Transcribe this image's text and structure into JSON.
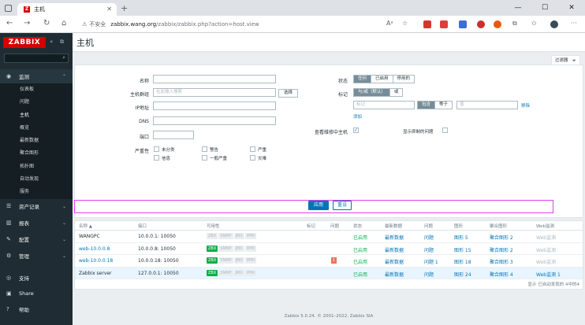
{
  "browser": {
    "tab_title": "主机",
    "tab_favicon": "Z",
    "url_warning": "不安全",
    "url_host": "zabbix.wang.org",
    "url_path": "/zabbix/zabbix.php?action=host.view"
  },
  "sidebar": {
    "logo": "ZABBIX",
    "menu": [
      {
        "label": "监测",
        "icon": "eye-icon"
      },
      {
        "label": "资产记录",
        "icon": "list-icon"
      },
      {
        "label": "报表",
        "icon": "chart-icon"
      },
      {
        "label": "配置",
        "icon": "wrench-icon"
      },
      {
        "label": "管理",
        "icon": "gear-icon"
      }
    ],
    "submenu": [
      "仪表板",
      "问题",
      "主机",
      "概览",
      "最新数据",
      "聚合图形",
      "拓扑图",
      "自动发现",
      "服务"
    ],
    "bottom": [
      {
        "label": "支持",
        "icon": "support-icon"
      },
      {
        "label": "Share",
        "icon": "share-icon"
      },
      {
        "label": "帮助",
        "icon": "help-icon"
      }
    ]
  },
  "page": {
    "title": "主机",
    "filter_tab": "过滤器"
  },
  "filter": {
    "name_label": "名称",
    "group_label": "主机群组",
    "group_placeholder": "在此输入搜索",
    "select_btn": "选择",
    "ip_label": "IP地址",
    "dns_label": "DNS",
    "port_label": "端口",
    "severity_label": "严重性",
    "severities": [
      "未分类",
      "警告",
      "严重",
      "信息",
      "一般严重",
      "灾难"
    ],
    "status_label": "状态",
    "status_options": [
      "任何",
      "已启用",
      "停用的"
    ],
    "tags_label": "标记",
    "tag_ops": [
      "与/或（默认）",
      "或"
    ],
    "tag_placeholder": "标记",
    "tag_contains": "包含",
    "tag_equals": "等于",
    "tag_value_placeholder": "值",
    "tag_remove": "移除",
    "tag_add": "添加",
    "maint_label": "查看维修中主机",
    "suppressed_label": "显示抑制的问题",
    "apply": "应用",
    "reset": "重设"
  },
  "table": {
    "headers": [
      "名称 ▲",
      "接口",
      "可用性",
      "标记",
      "问题",
      "状态",
      "最新数据",
      "问题",
      "图形",
      "聚合图形",
      "Web监测"
    ],
    "rows": [
      {
        "name": "WANGPC",
        "iface": "10.0.0.1: 10050",
        "status": "已启用",
        "latest": "最新数据",
        "problems": "问题",
        "graphs": "图形 5",
        "screens": "聚合图形 2",
        "web": "Web监测",
        "zbx_on": false,
        "problem_badge": ""
      },
      {
        "name": "web-10.0.0.8",
        "iface": "10.0.0.8: 10050",
        "status": "已启用",
        "latest": "最新数据",
        "problems": "问题",
        "graphs": "图形 15",
        "screens": "聚合图形 2",
        "web": "Web监测",
        "zbx_on": true,
        "problem_badge": ""
      },
      {
        "name": "web-10.0.0.18",
        "iface": "10.0.0.18: 10050",
        "status": "已启用",
        "latest": "最新数据",
        "problems": "问题 1",
        "graphs": "图形 18",
        "screens": "聚合图形 3",
        "web": "Web监测",
        "zbx_on": true,
        "problem_badge": "1"
      },
      {
        "name": "Zabbix server",
        "iface": "127.0.0.1: 10050",
        "status": "已启用",
        "latest": "最新数据",
        "problems": "问题",
        "graphs": "图形 24",
        "screens": "聚合图形 4",
        "web": "Web监测 1",
        "zbx_on": true,
        "problem_badge": ""
      }
    ],
    "avail_labels": [
      "ZBX",
      "SNMP",
      "JMX",
      "IPMI"
    ],
    "footer": "显示 已自动发现的 4中的4"
  },
  "footer": {
    "copyright": "Zabbix 5.0.24. © 2001–2022, Zabbix SIA"
  },
  "colors": {
    "brand": "#d40000",
    "sidebar": "#1f2c33",
    "link": "#0275b8",
    "enabled": "#0eaf4a",
    "annotation": "#e040e8"
  }
}
